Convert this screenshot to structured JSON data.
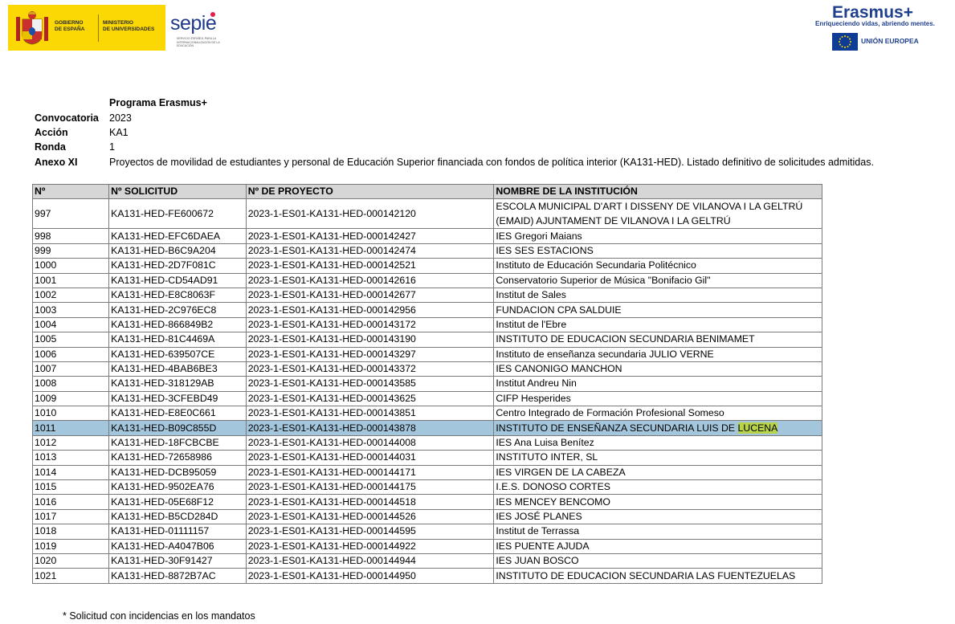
{
  "header": {
    "gobierno": "GOBIERNO\nDE ESPAÑA",
    "ministerio": "MINISTERIO\nDE UNIVERSIDADES",
    "sepie": "sepie",
    "sepie_sub": "SERVICIO ESPAÑOL PARA LA\nINTERNACIONALIZACIÓN DE LA EDUCACIÓN",
    "erasmus_title": "Erasmus+",
    "erasmus_tagline": "Enriqueciendo vidas, abriendo mentes.",
    "eu_label": "UNIÓN EUROPEA"
  },
  "meta": {
    "programa": "Programa Erasmus+",
    "rows": [
      {
        "label": "Convocatoria",
        "value": "2023"
      },
      {
        "label": "Acción",
        "value": "KA1"
      },
      {
        "label": "Ronda",
        "value": "1"
      },
      {
        "label": "Anexo XI",
        "value": "Proyectos de movilidad de estudiantes y personal de Educación Superior financiada con fondos de política interior (KA131-HED). Listado definitivo de solicitudes admitidas."
      }
    ]
  },
  "table": {
    "headers": [
      "Nº",
      "Nº SOLICITUD",
      "Nº DE PROYECTO",
      "NOMBRE DE LA INSTITUCIÓN"
    ],
    "highlight_word": "LUCENA",
    "rows": [
      {
        "n": "997",
        "solicitud": "KA131-HED-FE600672",
        "proyecto": "2023-1-ES01-KA131-HED-000142120",
        "institucion": "ESCOLA MUNICIPAL D'ART I DISSENY DE VILANOVA I LA GELTRÚ (EMAID) AJUNTAMENT DE VILANOVA I LA GELTRÚ"
      },
      {
        "n": "998",
        "solicitud": "KA131-HED-EFC6DAEA",
        "proyecto": "2023-1-ES01-KA131-HED-000142427",
        "institucion": "IES Gregori Maians"
      },
      {
        "n": "999",
        "solicitud": "KA131-HED-B6C9A204",
        "proyecto": "2023-1-ES01-KA131-HED-000142474",
        "institucion": "IES SES ESTACIONS"
      },
      {
        "n": "1000",
        "solicitud": "KA131-HED-2D7F081C",
        "proyecto": "2023-1-ES01-KA131-HED-000142521",
        "institucion": "Instituto de Educación Secundaria Politécnico"
      },
      {
        "n": "1001",
        "solicitud": "KA131-HED-CD54AD91",
        "proyecto": "2023-1-ES01-KA131-HED-000142616",
        "institucion": "Conservatorio Superior de Música \"Bonifacio Gil\""
      },
      {
        "n": "1002",
        "solicitud": "KA131-HED-E8C8063F",
        "proyecto": "2023-1-ES01-KA131-HED-000142677",
        "institucion": "Institut de Sales"
      },
      {
        "n": "1003",
        "solicitud": "KA131-HED-2C976EC8",
        "proyecto": "2023-1-ES01-KA131-HED-000142956",
        "institucion": "FUNDACION CPA SALDUIE"
      },
      {
        "n": "1004",
        "solicitud": "KA131-HED-866849B2",
        "proyecto": "2023-1-ES01-KA131-HED-000143172",
        "institucion": "Institut de l'Ebre"
      },
      {
        "n": "1005",
        "solicitud": "KA131-HED-81C4469A",
        "proyecto": "2023-1-ES01-KA131-HED-000143190",
        "institucion": "INSTITUTO DE EDUCACION SECUNDARIA BENIMAMET"
      },
      {
        "n": "1006",
        "solicitud": "KA131-HED-639507CE",
        "proyecto": "2023-1-ES01-KA131-HED-000143297",
        "institucion": "Instituto de enseñanza secundaria JULIO VERNE"
      },
      {
        "n": "1007",
        "solicitud": "KA131-HED-4BAB6BE3",
        "proyecto": "2023-1-ES01-KA131-HED-000143372",
        "institucion": "IES CANONIGO MANCHON"
      },
      {
        "n": "1008",
        "solicitud": "KA131-HED-318129AB",
        "proyecto": "2023-1-ES01-KA131-HED-000143585",
        "institucion": "Institut Andreu Nin"
      },
      {
        "n": "1009",
        "solicitud": "KA131-HED-3CFEBD49",
        "proyecto": "2023-1-ES01-KA131-HED-000143625",
        "institucion": "CIFP Hesperides"
      },
      {
        "n": "1010",
        "solicitud": "KA131-HED-E8E0C661",
        "proyecto": "2023-1-ES01-KA131-HED-000143851",
        "institucion": "Centro Integrado de Formación Profesional Someso"
      },
      {
        "n": "1011",
        "solicitud": "KA131-HED-B09C855D",
        "proyecto": "2023-1-ES01-KA131-HED-000143878",
        "institucion": "INSTITUTO DE ENSEÑANZA SECUNDARIA LUIS DE LUCENA",
        "highlighted": true
      },
      {
        "n": "1012",
        "solicitud": "KA131-HED-18FCBCBE",
        "proyecto": "2023-1-ES01-KA131-HED-000144008",
        "institucion": "IES Ana Luisa Benítez"
      },
      {
        "n": "1013",
        "solicitud": "KA131-HED-72658986",
        "proyecto": "2023-1-ES01-KA131-HED-000144031",
        "institucion": "INSTITUTO INTER, SL"
      },
      {
        "n": "1014",
        "solicitud": "KA131-HED-DCB95059",
        "proyecto": "2023-1-ES01-KA131-HED-000144171",
        "institucion": "IES VIRGEN DE LA CABEZA"
      },
      {
        "n": "1015",
        "solicitud": "KA131-HED-9502EA76",
        "proyecto": "2023-1-ES01-KA131-HED-000144175",
        "institucion": "I.E.S. DONOSO CORTES"
      },
      {
        "n": "1016",
        "solicitud": "KA131-HED-05E68F12",
        "proyecto": "2023-1-ES01-KA131-HED-000144518",
        "institucion": "IES MENCEY BENCOMO"
      },
      {
        "n": "1017",
        "solicitud": "KA131-HED-B5CD284D",
        "proyecto": "2023-1-ES01-KA131-HED-000144526",
        "institucion": "IES JOSÉ PLANES"
      },
      {
        "n": "1018",
        "solicitud": "KA131-HED-01111157",
        "proyecto": "2023-1-ES01-KA131-HED-000144595",
        "institucion": "Institut de Terrassa"
      },
      {
        "n": "1019",
        "solicitud": "KA131-HED-A4047B06",
        "proyecto": "2023-1-ES01-KA131-HED-000144922",
        "institucion": "IES PUENTE AJUDA"
      },
      {
        "n": "1020",
        "solicitud": "KA131-HED-30F91427",
        "proyecto": "2023-1-ES01-KA131-HED-000144944",
        "institucion": "IES JUAN BOSCO"
      },
      {
        "n": "1021",
        "solicitud": "KA131-HED-8872B7AC",
        "proyecto": "2023-1-ES01-KA131-HED-000144950",
        "institucion": "INSTITUTO DE EDUCACION SECUNDARIA LAS FUENTEZUELAS"
      }
    ]
  },
  "footnote": "* Solicitud con incidencias en los mandatos",
  "colors": {
    "gob_yellow": "#fbd804",
    "header_gray": "#d6d6d6",
    "row_highlight": "#a4c6dc",
    "word_highlight": "#b8d44a",
    "erasmus_blue": "#1f3f8f"
  }
}
